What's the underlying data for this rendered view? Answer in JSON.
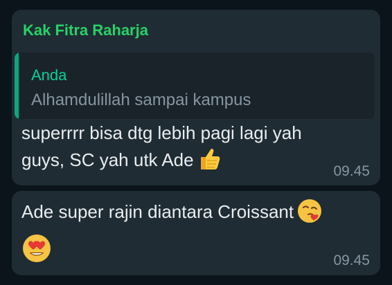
{
  "messages": [
    {
      "sender": "Kak Fitra Raharja",
      "quote": {
        "author": "Anda",
        "text": "Alhamdulillah sampai kampus"
      },
      "lines": [
        "superrrr bisa dtg lebih pagi lagi yah",
        "guys, SC yah utk Ade"
      ],
      "emoji": "thumbs-up-icon",
      "time": "09.45"
    },
    {
      "lines": [
        "Ade super rajin diantara Croissant"
      ],
      "emoji": [
        "face-blowing-kiss-icon",
        "heart-eyes-icon"
      ],
      "time": "09.45"
    }
  ],
  "colors": {
    "background": "#0b141a",
    "bubble": "#1f2c34",
    "sender": "#25d366",
    "quote_bar": "#06a884",
    "quote_author": "#06cf9c",
    "text": "#e9edef",
    "muted": "#8696a0"
  }
}
